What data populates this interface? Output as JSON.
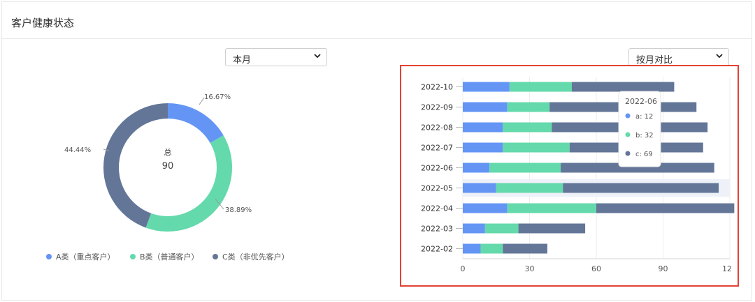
{
  "page": {
    "title": "客户健康状态"
  },
  "filters": {
    "period": {
      "selected": "本月"
    },
    "compare": {
      "selected": "按月对比"
    }
  },
  "colors": {
    "a": "#6495f5",
    "b": "#64d9ab",
    "c": "#637698"
  },
  "chart_data": [
    {
      "type": "pie",
      "title": "",
      "center_label": "总",
      "center_value": "90",
      "slices": [
        {
          "name": "A类（重点客户）",
          "percent": "16.67%",
          "value": 16.67,
          "color": "#6495f5"
        },
        {
          "name": "B类（普通客户）",
          "percent": "38.89%",
          "value": 38.89,
          "color": "#64d9ab"
        },
        {
          "name": "C类（非优先客户）",
          "percent": "44.44%",
          "value": 44.44,
          "color": "#637698"
        }
      ],
      "legend_position": "bottom"
    },
    {
      "type": "bar",
      "orientation": "horizontal",
      "stacked": true,
      "categories": [
        "2022-10",
        "2022-09",
        "2022-08",
        "2022-07",
        "2022-06",
        "2022-05",
        "2022-04",
        "2022-03",
        "2022-02"
      ],
      "series": [
        {
          "name": "a",
          "color": "#6495f5",
          "values": [
            21,
            20,
            18,
            18,
            12,
            15,
            20,
            10,
            8
          ]
        },
        {
          "name": "b",
          "color": "#64d9ab",
          "values": [
            28,
            19,
            22,
            30,
            32,
            30,
            40,
            15,
            10
          ]
        },
        {
          "name": "c",
          "color": "#637698",
          "values": [
            46,
            66,
            70,
            60,
            69,
            70,
            62,
            30,
            20
          ]
        }
      ],
      "xticks": [
        "0",
        "30",
        "60",
        "90",
        "12"
      ],
      "xlim": [
        0,
        120
      ],
      "grid": true,
      "highlighted_category": "2022-05",
      "tooltip": {
        "title": "2022-06",
        "rows": [
          {
            "label": "a: 12",
            "color": "#6495f5"
          },
          {
            "label": "b: 32",
            "color": "#64d9ab"
          },
          {
            "label": "c: 69",
            "color": "#637698"
          }
        ]
      }
    }
  ]
}
